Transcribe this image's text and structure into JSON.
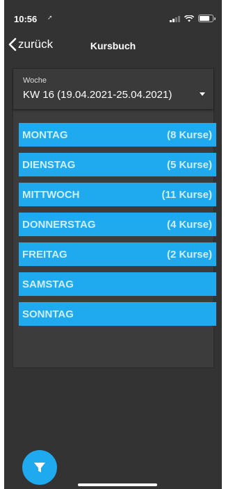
{
  "status": {
    "time": "10:56",
    "location_glyph": "➚"
  },
  "nav": {
    "back_label": "zurück",
    "title": "Kursbuch"
  },
  "week": {
    "label": "Woche",
    "value": "KW 16 (19.04.2021-25.04.2021)"
  },
  "days": [
    {
      "name": "MONTAG",
      "count": "(8 Kurse)"
    },
    {
      "name": "DIENSTAG",
      "count": "(5 Kurse)"
    },
    {
      "name": "MITTWOCH",
      "count": "(11 Kurse)"
    },
    {
      "name": "DONNERSTAG",
      "count": "(4 Kurse)"
    },
    {
      "name": "FREITAG",
      "count": "(2 Kurse)"
    },
    {
      "name": "SAMSTAG",
      "count": ""
    },
    {
      "name": "SONNTAG",
      "count": ""
    }
  ],
  "icons": {
    "back": "chevron-left-icon",
    "dropdown": "caret-down-icon",
    "fab": "filter-icon"
  },
  "colors": {
    "accent": "#1fa9ef",
    "background": "#333333",
    "panel": "#3c3c3c"
  }
}
